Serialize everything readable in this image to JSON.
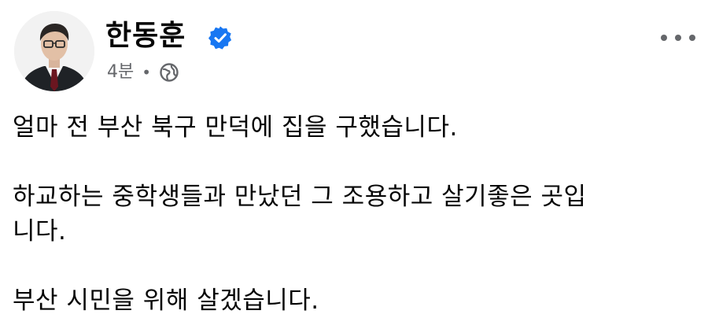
{
  "post": {
    "author": "한동훈",
    "time": "4분",
    "separator": "•",
    "audience_icon": "globe-icon",
    "verified_icon": "verified-badge-icon",
    "more_icon": "more-options-icon",
    "paragraphs": [
      "얼마 전 부산 북구 만덕에 집을 구했습니다.",
      "하교하는 중학생들과 만났던 그 조용하고 살기좋은 곳입니다.",
      "부산 시민을 위해 살겠습니다."
    ]
  },
  "colors": {
    "text": "#050505",
    "meta": "#65676b",
    "verified": "#1877f2"
  }
}
